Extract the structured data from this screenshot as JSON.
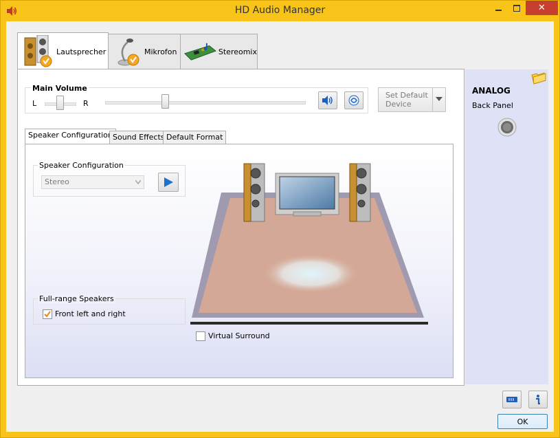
{
  "window": {
    "title": "HD Audio Manager"
  },
  "main_tabs": [
    {
      "label": "Lautsprecher",
      "active": true
    },
    {
      "label": "Mikrofon",
      "active": false
    },
    {
      "label": "Stereomix",
      "active": false
    }
  ],
  "main_volume": {
    "label": "Main Volume",
    "left_label": "L",
    "right_label": "R",
    "balance_fraction": 0.5,
    "volume_fraction": 0.3
  },
  "default_device": {
    "label_line1": "Set Default",
    "label_line2": "Device"
  },
  "sub_tabs": [
    {
      "label": "Speaker Configuration",
      "active": true
    },
    {
      "label": "Sound Effects",
      "active": false
    },
    {
      "label": "Default Format",
      "active": false
    }
  ],
  "speaker_config": {
    "group_label": "Speaker Configuration",
    "selected": "Stereo"
  },
  "full_range": {
    "group_label": "Full-range Speakers",
    "checkbox_label": "Front left and right",
    "checked": true
  },
  "virtual_surround": {
    "label": "Virtual Surround",
    "checked": false
  },
  "right_panel": {
    "title": "ANALOG",
    "subtitle": "Back Panel"
  },
  "footer": {
    "ok_label": "OK"
  },
  "colors": {
    "accent": "#f9c41a",
    "close": "#c7402f",
    "right_panel": "#dfe1f6"
  }
}
